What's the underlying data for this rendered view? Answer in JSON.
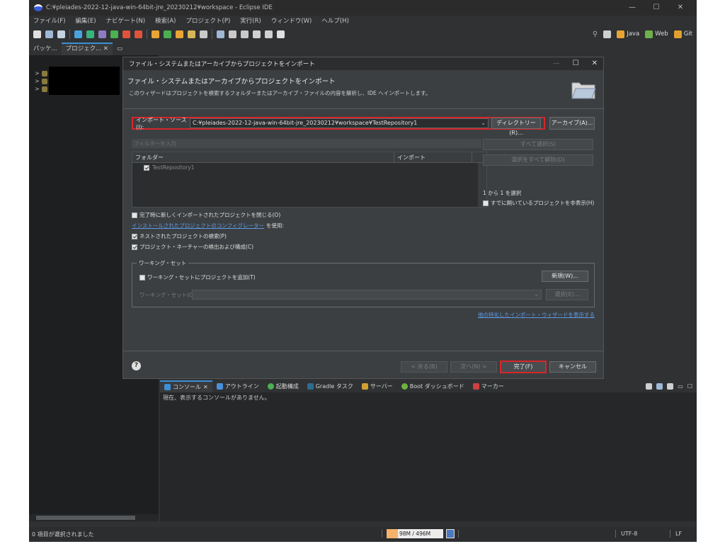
{
  "window": {
    "title": "C:¥pleiades-2022-12-java-win-64bit-jre_20230212¥workspace - Eclipse IDE",
    "controls": [
      "—",
      "☐",
      "✕"
    ]
  },
  "menu": [
    "ファイル(F)",
    "編集(E)",
    "ナビゲート(N)",
    "検索(A)",
    "プロジェクト(P)",
    "実行(R)",
    "ウィンドウ(W)",
    "ヘルプ(H)"
  ],
  "perspectives": [
    {
      "label": "Java",
      "color": "#e8a534"
    },
    {
      "label": "Web",
      "color": "#6fb04a"
    },
    {
      "label": "Git",
      "color": "#e0a030"
    }
  ],
  "left_panel": {
    "tabs": [
      "パッケ...",
      "プロジェク... ✕"
    ],
    "tree_markers": [
      ">",
      ">",
      ">"
    ]
  },
  "dialog": {
    "title": "ファイル・システムまたはアーカイブからプロジェクトをインポート",
    "heading": "ファイル・システムまたはアーカイブからプロジェクトをインポート",
    "description": "このウィザードはプロジェクトを検索するフォルダーまたはアーカイブ・ファイルの内容を解析し、IDE へインポートします。",
    "source_label": "インポート・ソース(I):",
    "source_value": "C:¥pleiades-2022-12-java-win-64bit-jre_20230212¥workspace¥TestRepository1",
    "directory_button": "ディレクトリー(R)...",
    "archive_button": "アーカイブ(A)...",
    "filter_placeholder": "フィルターを入力",
    "table": {
      "col_folder": "フォルダー",
      "col_import": "インポート",
      "rows": [
        {
          "name": "TestRepository1",
          "checked": true
        }
      ]
    },
    "select_all": "すべて選択(S)",
    "deselect_all": "選択をすべて解除(D)",
    "selection_count": "1 から 1 を選択",
    "hide_open": "すでに開いているプロジェクトを非表示(H)",
    "close_new": "完了時に新しくインポートされたプロジェクトを閉じる(O)",
    "configurators_link": "インストールされたプロジェクトのコンフィグレーター",
    "configurators_suffix": "を使用:",
    "search_nested": "ネストされたプロジェクトの検索(P)",
    "detect_nature": "プロジェクト・ネーチャーの検出および構成(C)",
    "working_set": {
      "legend": "ワーキング・セット",
      "add_label": "ワーキング・セットにプロジェクトを追加(T)",
      "new_button": "新規(W)...",
      "field_label": "ワーキング・セット(O):",
      "select_button": "選択(E)..."
    },
    "other_link": "他の特化したインポート・ウィザードを表示する",
    "footer": {
      "help": "?",
      "back": "< 戻る(B)",
      "next": "次へ(N) >",
      "finish": "完了(F)",
      "cancel": "キャンセル"
    }
  },
  "console": {
    "tabs": [
      {
        "label": "コンソール",
        "color": "#3d8fd6",
        "active": true
      },
      {
        "label": "アウトライン",
        "color": "#4a90d9",
        "active": false
      },
      {
        "label": "起動構成",
        "color": "#4caf50",
        "active": false
      },
      {
        "label": "Gradle タスク",
        "color": "#2f6b8f",
        "active": false
      },
      {
        "label": "サーバー",
        "color": "#d0a030",
        "active": false
      },
      {
        "label": "Boot ダッシュボード",
        "color": "#6db33f",
        "active": false
      },
      {
        "label": "マーカー",
        "color": "#d04040",
        "active": false
      }
    ],
    "message": "現在、表示するコンソールがありません。"
  },
  "status": {
    "left": "0 項目が選択されました",
    "heap": "98M / 496M",
    "heap_used_fraction": 0.2,
    "encoding": "UTF-8",
    "line_ending": "LF"
  }
}
